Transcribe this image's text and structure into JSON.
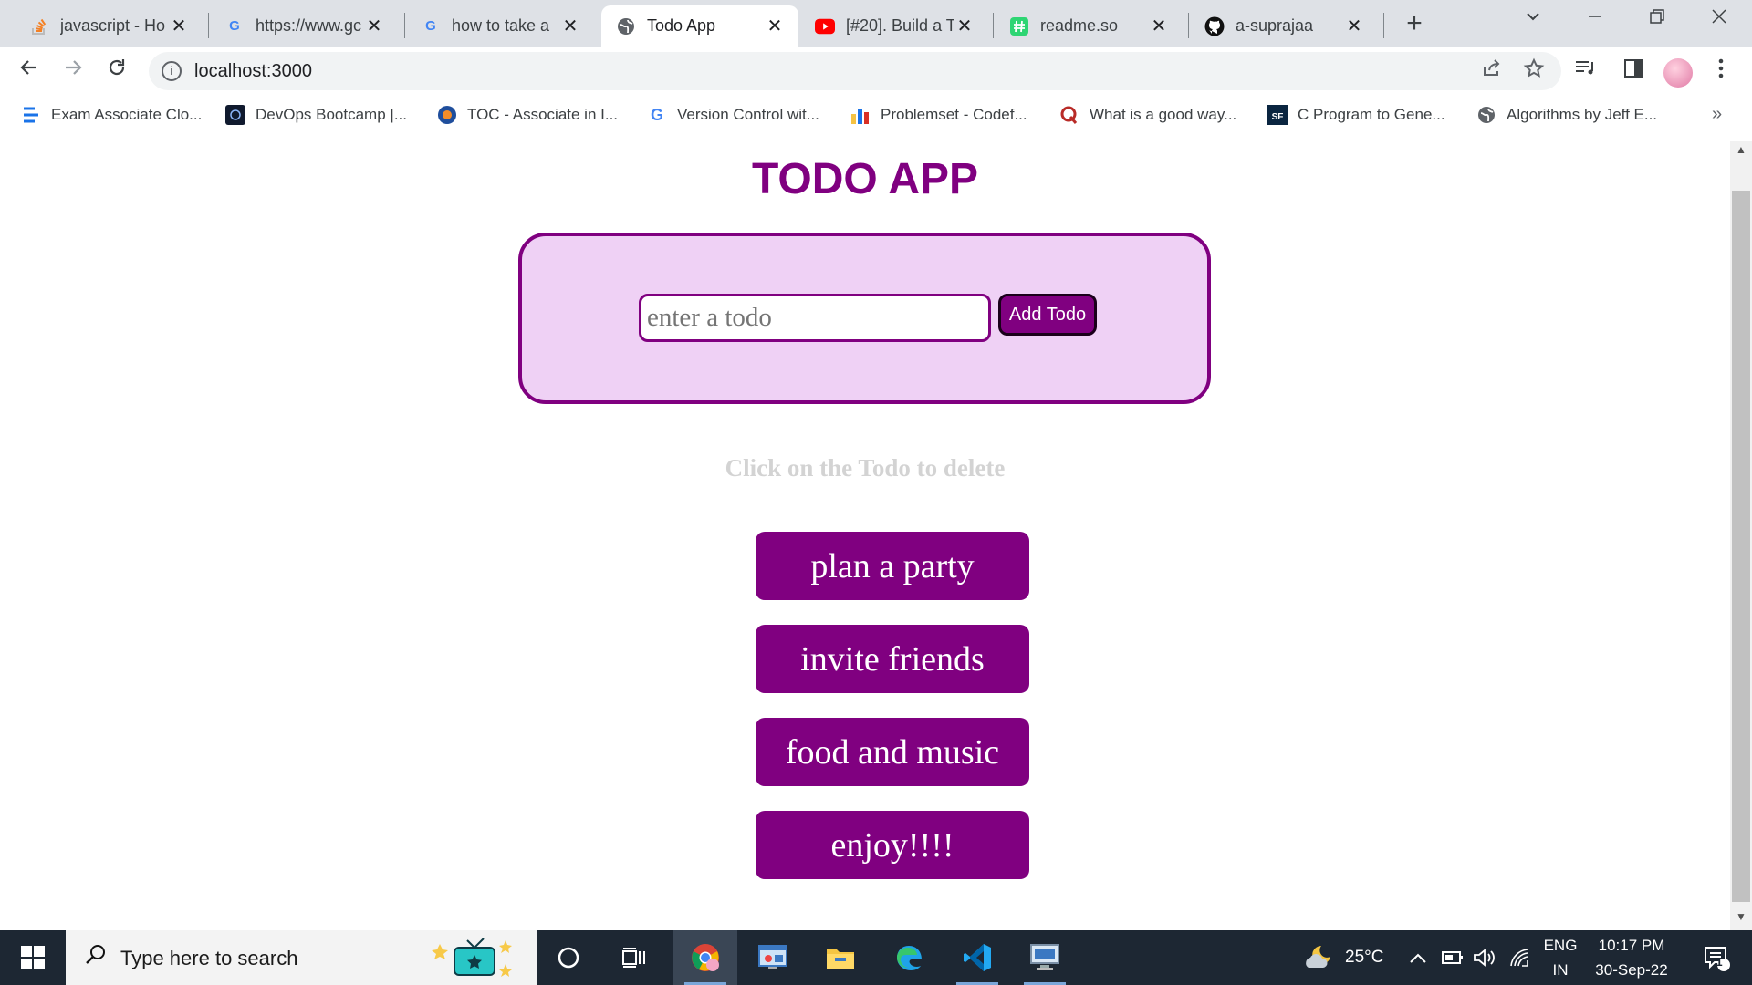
{
  "tabs": [
    {
      "title": "javascript - Ho",
      "icon": "stackoverflow-icon",
      "active": false
    },
    {
      "title": "https://www.gc",
      "icon": "google-icon",
      "active": false
    },
    {
      "title": "how to take a",
      "icon": "google-icon",
      "active": false
    },
    {
      "title": "Todo App",
      "icon": "globe-icon",
      "active": true
    },
    {
      "title": "[#20]. Build a T",
      "icon": "youtube-icon",
      "active": false
    },
    {
      "title": "readme.so",
      "icon": "readme-icon",
      "active": false
    },
    {
      "title": "a-suprajaa",
      "icon": "github-icon",
      "active": false
    }
  ],
  "address_bar": {
    "url": "localhost:3000"
  },
  "bookmarks": [
    {
      "label": "Exam Associate Clo...",
      "icon": "menu-lines-icon"
    },
    {
      "label": "DevOps Bootcamp |...",
      "icon": "devops-icon"
    },
    {
      "label": "TOC - Associate in I...",
      "icon": "toc-icon"
    },
    {
      "label": "Version Control wit...",
      "icon": "google-icon"
    },
    {
      "label": "Problemset - Codef...",
      "icon": "codeforces-icon"
    },
    {
      "label": "What is a good way...",
      "icon": "quora-icon"
    },
    {
      "label": "C Program to Gene...",
      "icon": "sf-icon"
    },
    {
      "label": "Algorithms by Jeff E...",
      "icon": "globe-icon"
    }
  ],
  "app": {
    "title": "TODO APP",
    "input_placeholder": "enter a todo",
    "add_button": "Add Todo",
    "hint": "Click on the Todo to delete",
    "todos": [
      "plan a party",
      "invite friends",
      "food and music",
      "enjoy!!!!"
    ],
    "colors": {
      "primary": "#800080",
      "form_bg": "#efd1f5",
      "hint": "#d3d3d3"
    }
  },
  "taskbar": {
    "search_placeholder": "Type here to search",
    "weather": "25°C",
    "language": "ENG",
    "region": "IN",
    "time": "10:17 PM",
    "date": "30-Sep-22",
    "notifications": "1"
  }
}
